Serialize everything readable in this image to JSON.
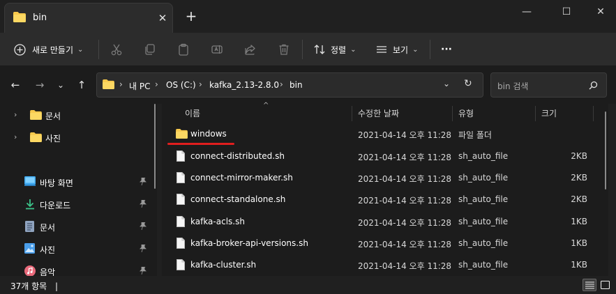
{
  "tab": {
    "title": "bin",
    "close_glyph": "✕",
    "new_tab_glyph": "+"
  },
  "window": {
    "minimize": "—",
    "maximize": "☐",
    "close": "✕"
  },
  "toolbar": {
    "new_label": "새로 만들기",
    "new_chevron": "⌄",
    "sort_label": "정렬",
    "view_label": "보기",
    "more_label": "···"
  },
  "nav": {
    "back": "←",
    "forward": "→",
    "recent": "⌄",
    "up": "↑",
    "refresh": "↻"
  },
  "address": {
    "crumbs": [
      "내 PC",
      "OS (C:)",
      "kafka_2.13-2.8.0",
      "bin"
    ],
    "separator": "›",
    "dropdown": "⌄"
  },
  "search": {
    "placeholder": "bin 검색"
  },
  "sidebar": {
    "items": [
      {
        "label": "문서",
        "icon": "folder-icon"
      },
      {
        "label": "사진",
        "icon": "folder-icon"
      },
      {
        "label": "바탕 화면",
        "icon": "desktop-icon"
      },
      {
        "label": "다운로드",
        "icon": "download-icon"
      },
      {
        "label": "문서",
        "icon": "document-icon"
      },
      {
        "label": "사진",
        "icon": "pictures-icon"
      },
      {
        "label": "음악",
        "icon": "music-icon"
      }
    ],
    "chevron": "›"
  },
  "columns": {
    "name": "이름",
    "date": "수정한 날짜",
    "type": "유형",
    "size": "크기",
    "sort_glyph": "^"
  },
  "files": [
    {
      "name": "windows",
      "date": "2021-04-14 오후 11:28",
      "type": "파일 폴더",
      "size": "",
      "icon": "folder-icon"
    },
    {
      "name": "connect-distributed.sh",
      "date": "2021-04-14 오후 11:28",
      "type": "sh_auto_file",
      "size": "2KB",
      "icon": "file-icon"
    },
    {
      "name": "connect-mirror-maker.sh",
      "date": "2021-04-14 오후 11:28",
      "type": "sh_auto_file",
      "size": "2KB",
      "icon": "file-icon"
    },
    {
      "name": "connect-standalone.sh",
      "date": "2021-04-14 오후 11:28",
      "type": "sh_auto_file",
      "size": "2KB",
      "icon": "file-icon"
    },
    {
      "name": "kafka-acls.sh",
      "date": "2021-04-14 오후 11:28",
      "type": "sh_auto_file",
      "size": "1KB",
      "icon": "file-icon"
    },
    {
      "name": "kafka-broker-api-versions.sh",
      "date": "2021-04-14 오후 11:28",
      "type": "sh_auto_file",
      "size": "1KB",
      "icon": "file-icon"
    },
    {
      "name": "kafka-cluster.sh",
      "date": "2021-04-14 오후 11:28",
      "type": "sh_auto_file",
      "size": "1KB",
      "icon": "file-icon"
    }
  ],
  "status": {
    "item_count": "37개 항목",
    "cursor": "|"
  },
  "colors": {
    "folder": "#f8c94c",
    "accent": "#4cc2ff",
    "underline": "#e01e1e"
  }
}
